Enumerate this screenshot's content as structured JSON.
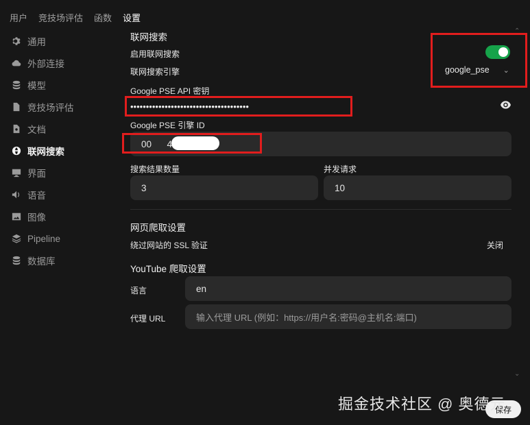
{
  "nav": {
    "tabs": [
      "用户",
      "竞技场评估",
      "函数",
      "设置"
    ]
  },
  "sidebar": {
    "items": [
      {
        "label": "通用",
        "icon": "gear-icon"
      },
      {
        "label": "外部连接",
        "icon": "cloud-icon"
      },
      {
        "label": "模型",
        "icon": "database-icon"
      },
      {
        "label": "竞技场评估",
        "icon": "document-icon"
      },
      {
        "label": "文档",
        "icon": "document-icon"
      },
      {
        "label": "联网搜索",
        "icon": "globe-icon"
      },
      {
        "label": "界面",
        "icon": "monitor-icon"
      },
      {
        "label": "语音",
        "icon": "speaker-icon"
      },
      {
        "label": "图像",
        "icon": "image-icon"
      },
      {
        "label": "Pipeline",
        "icon": "layers-icon"
      },
      {
        "label": "数据库",
        "icon": "database-icon"
      }
    ]
  },
  "search": {
    "section_title": "联网搜索",
    "enable_label": "启用联网搜索",
    "engine_label": "联网搜索引擎",
    "engine_value": "google_pse",
    "api_key_label": "Google PSE API 密钥",
    "api_key_value": "••••••••••••••••••••••••••••••••••••••",
    "engine_id_label": "Google PSE 引擎 ID",
    "engine_id_value": "00      4b3f",
    "result_count_label": "搜索结果数量",
    "result_count_value": "3",
    "concurrent_label": "并发请求",
    "concurrent_value": "10"
  },
  "crawl": {
    "section_title": "网页爬取设置",
    "ssl_label": "绕过网站的 SSL 验证",
    "ssl_value": "关闭"
  },
  "youtube": {
    "section_title": "YouTube 爬取设置",
    "language_label": "语言",
    "language_value": "en",
    "proxy_label": "代理 URL",
    "proxy_placeholder": "输入代理 URL (例如：https://用户名:密码@主机名:端口)"
  },
  "footer": {
    "watermark": "掘金技术社区 @ 奥德元",
    "save_label": "保存"
  },
  "colors": {
    "toggle_on": "#16a34a",
    "highlight_box": "#e11d1d"
  }
}
